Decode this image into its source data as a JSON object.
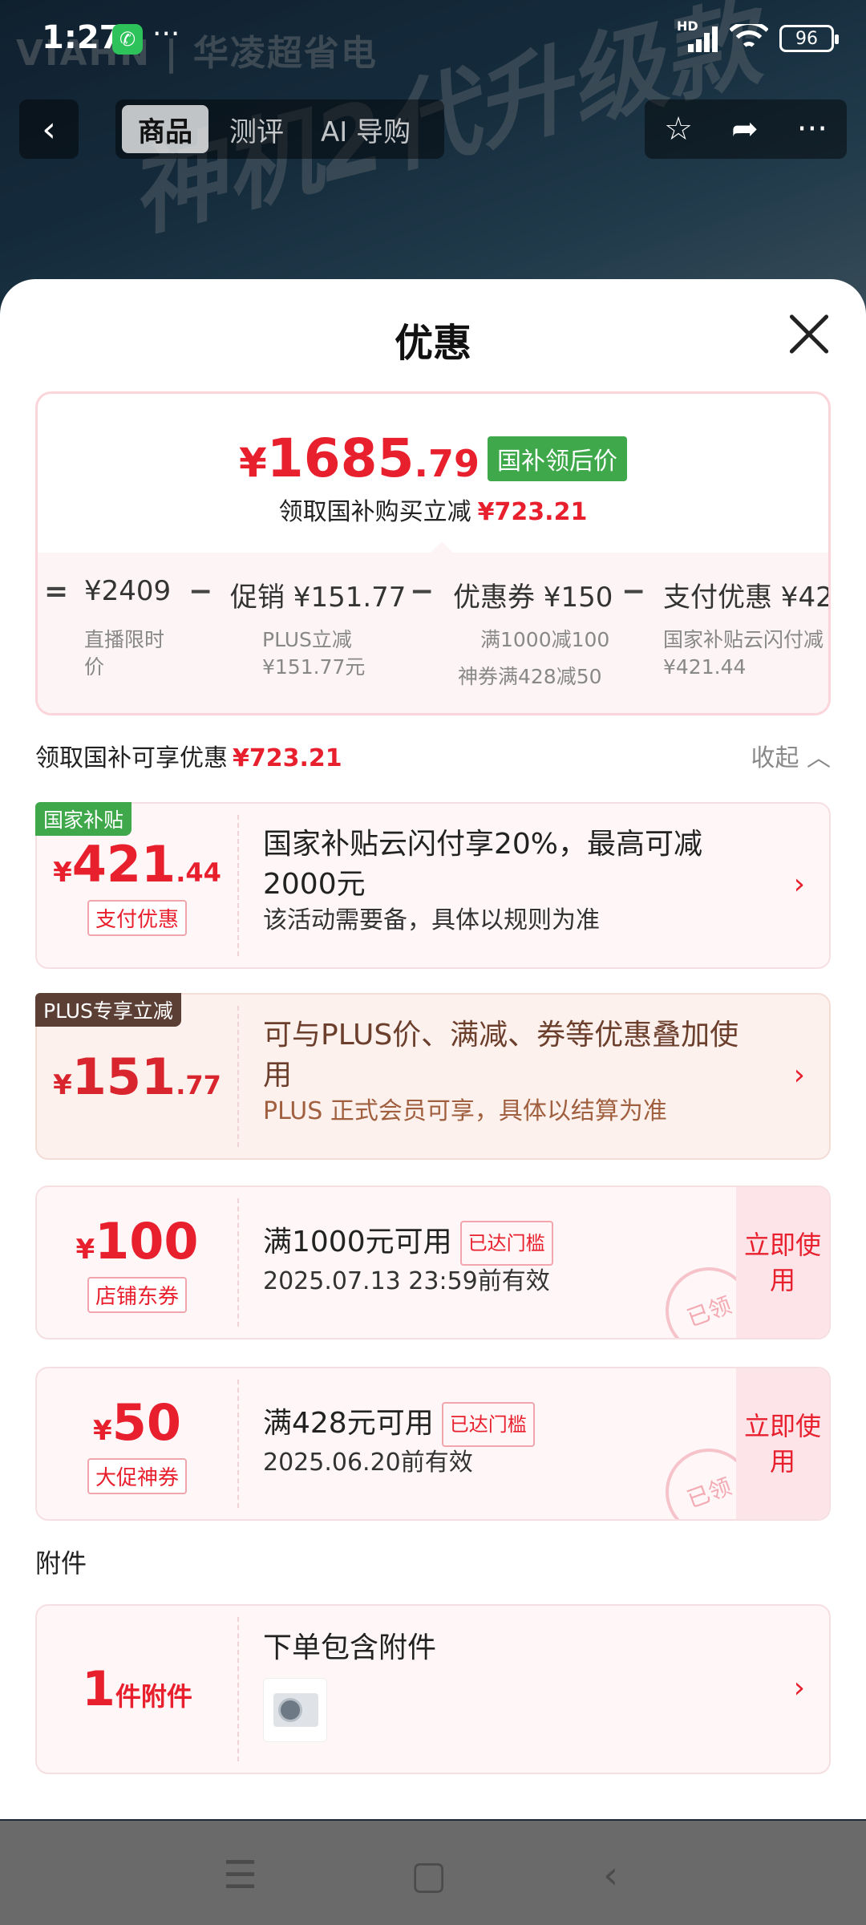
{
  "background": {
    "brand_text": "VIAHN | 华凌超省电",
    "slogan_text": "神机2代升级款"
  },
  "status_bar": {
    "time": "1:27",
    "network": "HD",
    "battery": "96"
  },
  "top_nav": {
    "tabs": [
      {
        "label": "商品",
        "active": true
      },
      {
        "label": "测评",
        "active": false
      },
      {
        "label": "AI 导购",
        "active": false
      }
    ]
  },
  "sheet": {
    "title": "优惠",
    "summary": {
      "price_symbol": "¥",
      "price_int": "1685",
      "price_dec": ".79",
      "badge": "国补领后价",
      "subtitle": "领取国补购买立减",
      "subtitle_amount": "¥723.21",
      "breakdown": [
        {
          "op": "=",
          "label": "¥2409",
          "note_line1": "直播限时",
          "note_line2": "价"
        },
        {
          "op": "−",
          "label": "促销 ¥151.77",
          "note_line1": "PLUS立减",
          "note_line2": "¥151.77元"
        },
        {
          "op": "−",
          "label": "优惠券 ¥150",
          "note_line1": "满1000减100",
          "note_line2": "神券满428减50"
        },
        {
          "op": "−",
          "label": "支付优惠 ¥42",
          "note_line1": "国家补贴云闪付减",
          "note_line2": "¥421.44"
        }
      ]
    },
    "section_title": "领取国补可享优惠",
    "section_amount": "¥723.21",
    "collapse_label": "收起",
    "offers": [
      {
        "corner": "国家补贴",
        "sym": "¥",
        "int": "421",
        "dec": ".44",
        "tag": "支付优惠",
        "title": "国家补贴云闪付享20%，最高可减2000元",
        "desc": "该活动需要备，具体以规则为准"
      },
      {
        "corner": "PLUS专享立减",
        "sym": "¥",
        "int": "151",
        "dec": ".77",
        "title": "可与PLUS价、满减、券等优惠叠加使用",
        "desc": "PLUS 正式会员可享，具体以结算为准"
      },
      {
        "sym": "¥",
        "int": "100",
        "tag": "店铺东券",
        "title": "满1000元可用",
        "pill": "已达门槛",
        "desc": "2025.07.13 23:59前有效",
        "button": "立即使用",
        "stamp": "已领"
      },
      {
        "sym": "¥",
        "int": "50",
        "tag": "大促神券",
        "title": "满428元可用",
        "pill": "已达门槛",
        "desc": "2025.06.20前有效",
        "button": "立即使用",
        "stamp": "已领"
      }
    ],
    "attachments_label": "附件",
    "attachment": {
      "count": "1",
      "unit": "件附件",
      "title": "下单包含附件"
    }
  },
  "colors": {
    "accent_red": "#e8202e",
    "green_badge": "#3ea84b",
    "plus_brown": "#5b3f35"
  }
}
